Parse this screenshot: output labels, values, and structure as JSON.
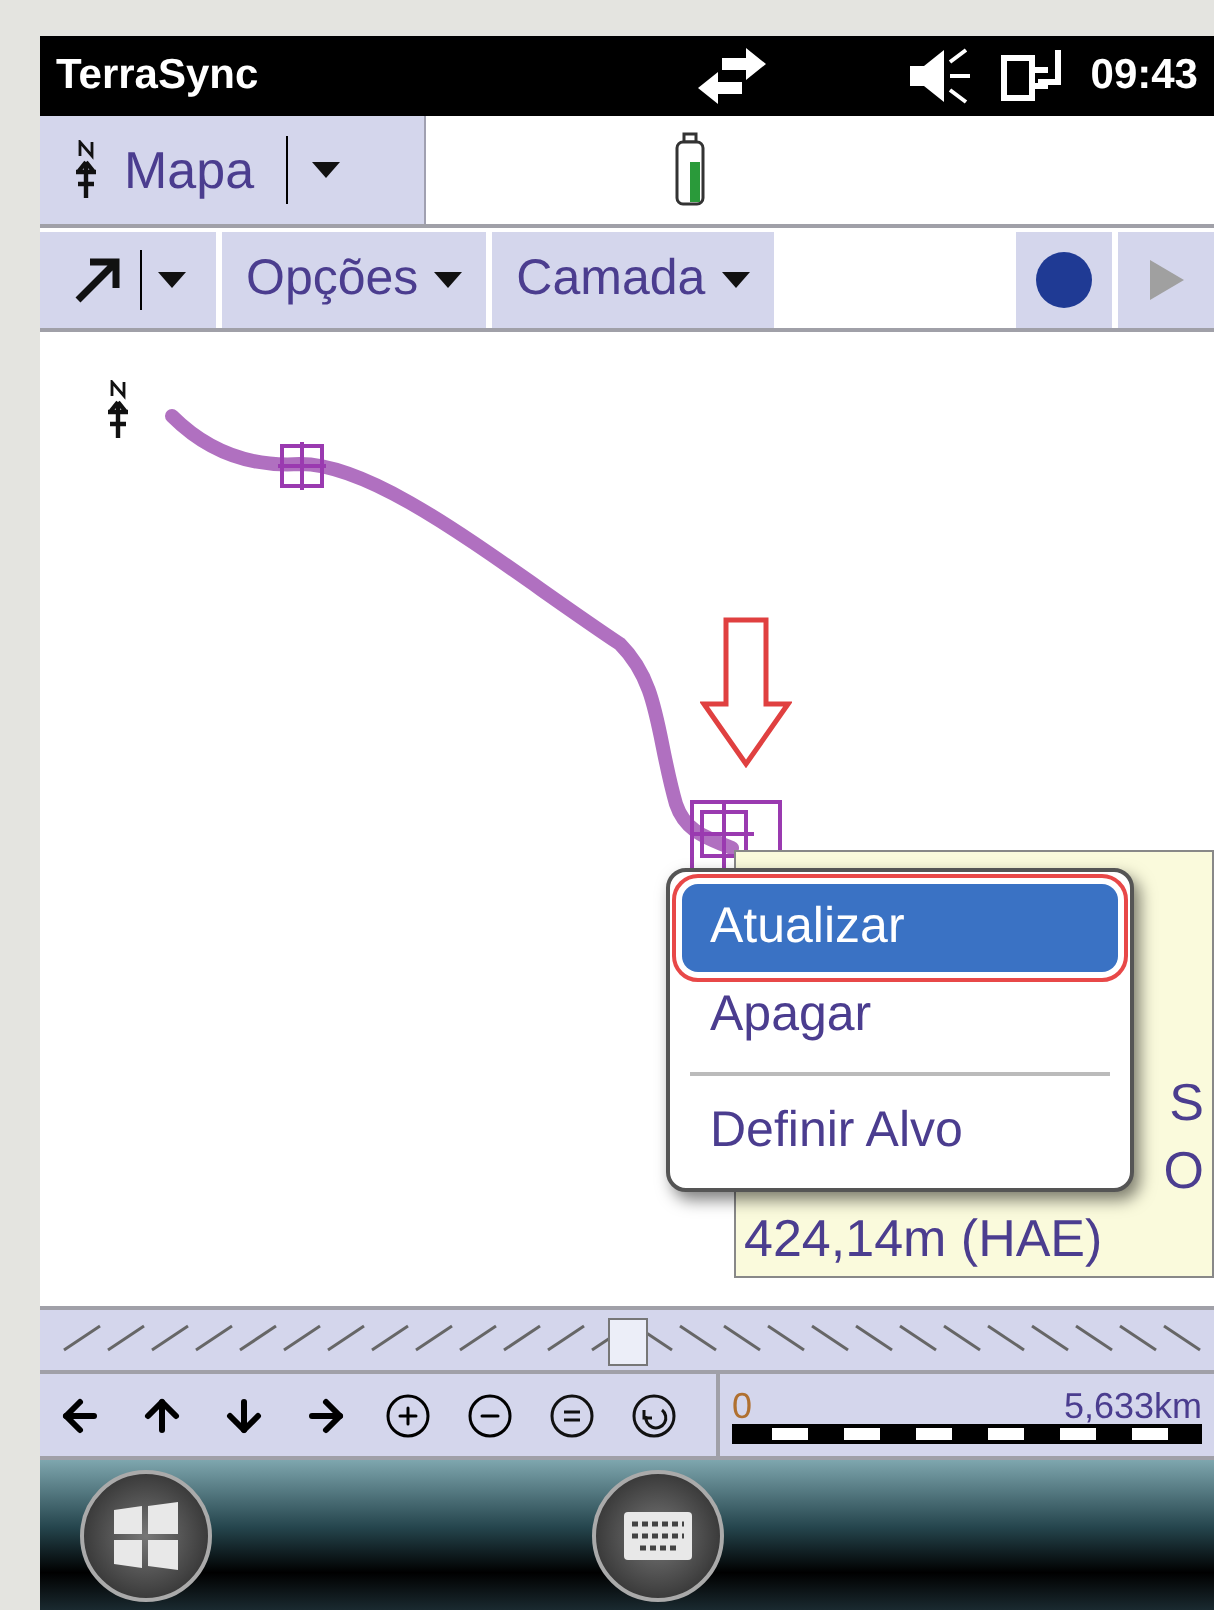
{
  "status_bar": {
    "app_name": "TerraSync",
    "time": "09:43"
  },
  "view_menu": {
    "label": "Mapa"
  },
  "toolbar": {
    "buttons": [
      {
        "label": "Opções"
      },
      {
        "label": "Camada"
      }
    ]
  },
  "map": {
    "info_lines": [
      "S",
      "O",
      "424,14m (HAE)"
    ],
    "context_menu": [
      {
        "kind": "item",
        "label": "Atualizar",
        "selected": true
      },
      {
        "kind": "item",
        "label": "Apagar",
        "selected": false
      },
      {
        "kind": "separator"
      },
      {
        "kind": "item",
        "label": "Definir Alvo",
        "selected": false
      }
    ]
  },
  "zoom_slider": {
    "level": 0.5
  },
  "scale": {
    "start": "0",
    "end": "5,633km"
  }
}
